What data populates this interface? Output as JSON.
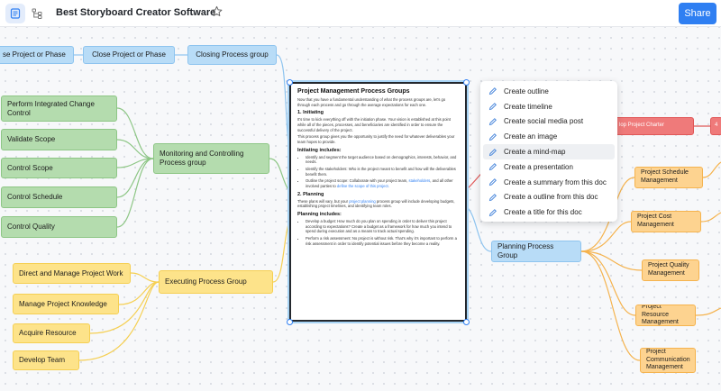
{
  "topbar": {
    "title": "Best Storyboard Creator Software",
    "more_label": "···",
    "share_label": "Share",
    "icons": [
      "document-icon",
      "mindmap-icon",
      "star-icon"
    ]
  },
  "nodes": {
    "close_project_phase_partial": "se Project or Phase",
    "close_project_phase": "Close Project or Phase",
    "closing_process_group": "Closing Process group",
    "perform_integrated_change_control": "Perform Integrated  Change Control",
    "validate_scope": "Validate Scope",
    "control_scope": "Control Scope",
    "control_schedule": "Control Schedule",
    "control_quality": "Control Quality",
    "monitoring_controlling": "Monitoring and Controlling Process group",
    "direct_manage_work": "Direct and Manage Project Work",
    "manage_project_knowledge": "Manage Project Knowledge",
    "acquire_resource": "Acquire Resource",
    "develop_team": "Develop Team",
    "executing_process_group": "Executing Process Group",
    "planning_process_group": "Planning Process Group",
    "develop_project_charter_partial": "lop Project Charter",
    "red_partial": "4",
    "project_schedule_management": "Project Schedule Management",
    "project_cost_management": "Project Cost Management",
    "project_quality_management": "Project Quality Management",
    "project_resource_management": "Project Resource Management",
    "project_communication_management": "Project Communication Management"
  },
  "doc": {
    "title": "Project Management Process Groups",
    "intro": "Now that you have a fundamental understanding of what the process groups are, let's go through each process and go through the average expectations for each one.",
    "s1_heading": "1. Initiating",
    "s1_p1": "It's time to kick everything off with the initiation phase. Your vision is established at this point while all of the pieces, processes, and beneficiaries are identified in order to ensure the successful delivery of the project.",
    "s1_p2": "This process group gives you the opportunity to justify the need for whatever deliverables your team hopes to provide.",
    "initiating_includes": "Initiating includes:",
    "init_b1": "Identify and segment the target audience based on demographics, interests, behavior, and needs.",
    "init_b2": "Identify the stakeholders: Who is the project meant to benefit and how will the deliverables benefit them.",
    "init_b3_pre": "Outline the project scope: Collaborate with your project team, ",
    "init_b3_link1": "stakeholders",
    "init_b3_mid": ", and all other involved parties to ",
    "init_b3_link2": "define the scope of this project.",
    "s2_heading": "2. Planning",
    "s2_p_pre": "These plans will vary, but your ",
    "s2_p_link": "project planning",
    "s2_p_post": " process group will include developing budgets, establishing project timelines, and identifying team roles.",
    "planning_includes": "Planning includes:",
    "plan_b1": "Develop a budget: How much do you plan on spending in order to deliver this project according to expectations? Create a budget as a framework for how much you intend to spend during execution and as a means to track actual spending.",
    "plan_b2": "Perform a risk assessment: No project is without risk. That's why it's important to perform a risk assessment in order to identify potential issues before they become a reality."
  },
  "menu": {
    "items": [
      "Create outline",
      "Create timeline",
      "Create social media post",
      "Create an image",
      "Create a mind-map",
      "Create a presentation",
      "Create a summary from this doc",
      "Create a outline from this doc",
      "Create a title for this doc"
    ],
    "highlighted": "Create a mind-map"
  },
  "colors": {
    "accent": "#2f7ff2",
    "blue_node": "#b8dcf7",
    "green_node": "#b4dcae",
    "yellow_node": "#fde38a",
    "orange_node": "#fdd390",
    "red_node": "#ef7a7a"
  }
}
